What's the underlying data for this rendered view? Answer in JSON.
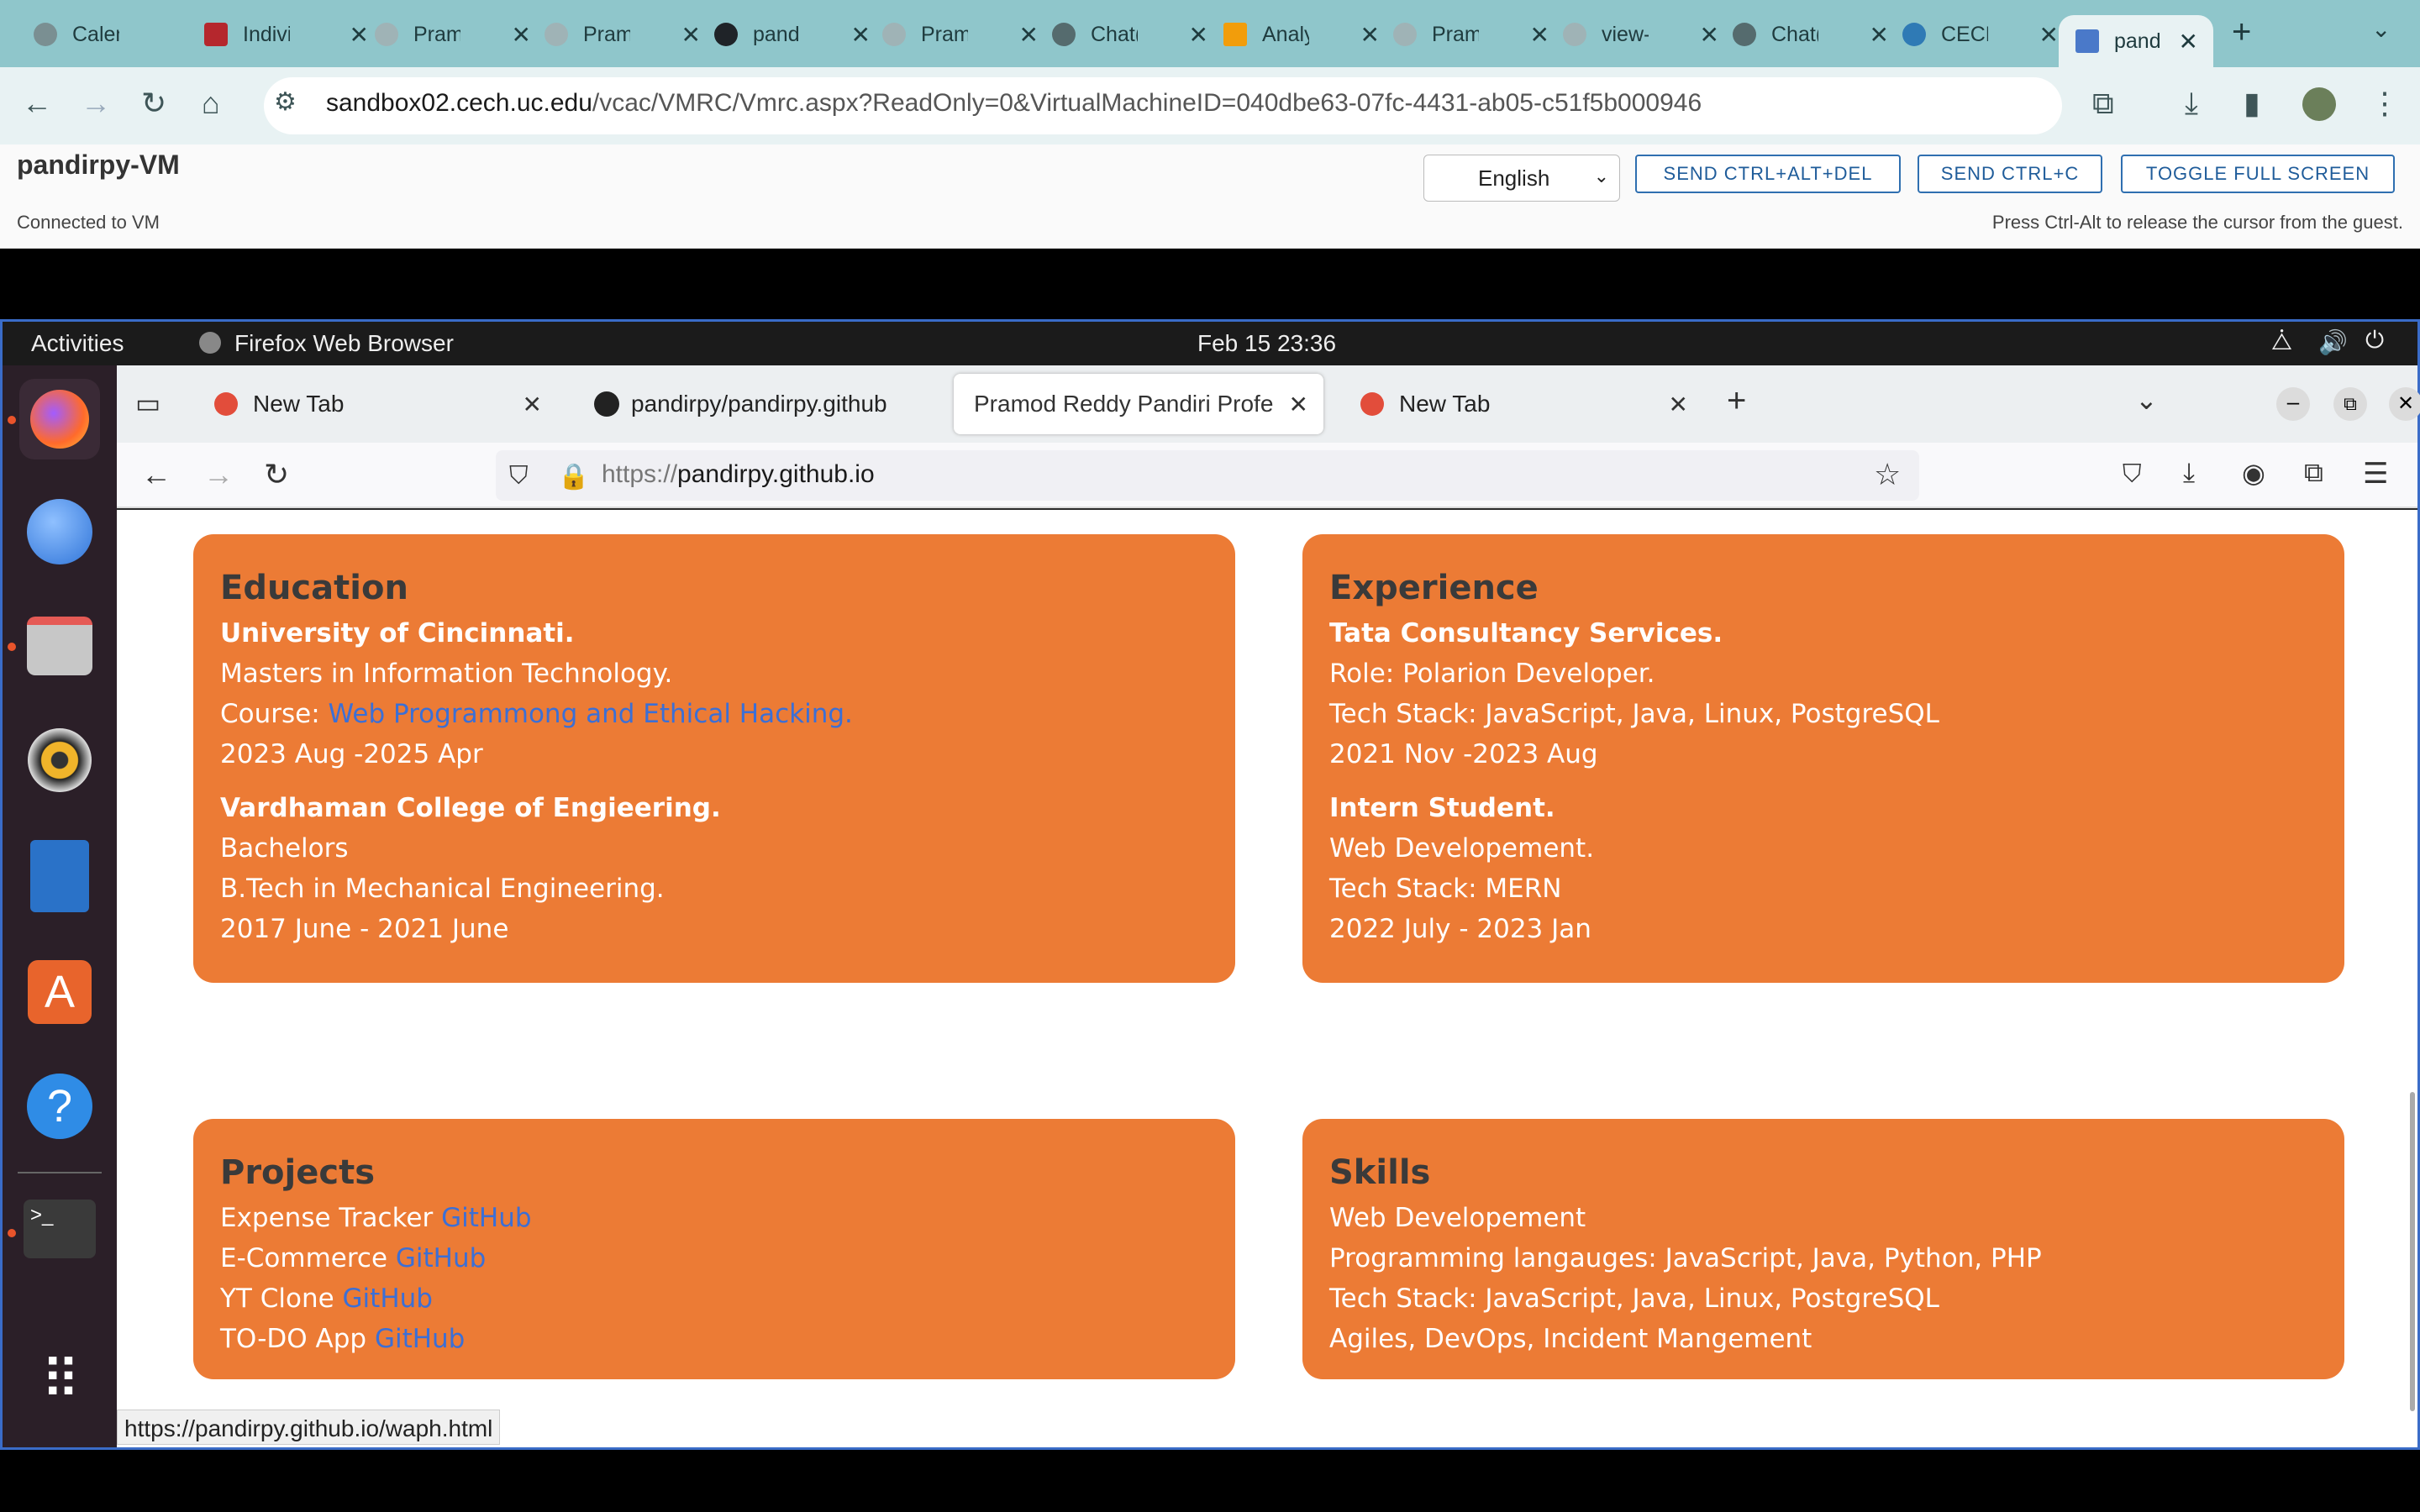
{
  "chrome": {
    "tabs": [
      {
        "label": "Calen"
      },
      {
        "label": "Indivi"
      },
      {
        "label": "Pram"
      },
      {
        "label": "Pram"
      },
      {
        "label": "pand"
      },
      {
        "label": "Pram"
      },
      {
        "label": "Chat("
      },
      {
        "label": "Analy"
      },
      {
        "label": "Pram"
      },
      {
        "label": "view-"
      },
      {
        "label": "Chat("
      },
      {
        "label": "CECH"
      },
      {
        "label": "pand"
      }
    ],
    "new_tab": "+",
    "close": "✕",
    "url_host": "sandbox02.cech.uc.edu",
    "url_path": "/vcac/VMRC/Vmrc.aspx?ReadOnly=0&VirtualMachineID=040dbe63-07fc-4431-ab05-c51f5b000946"
  },
  "vmrc": {
    "title": "pandirpy-VM",
    "status": "Connected to VM",
    "hint": "Press Ctrl-Alt to release the cursor from the guest.",
    "language": "English",
    "btn_cad": "SEND CTRL+ALT+DEL",
    "btn_cc": "SEND CTRL+C",
    "btn_fs": "TOGGLE FULL SCREEN"
  },
  "gnome": {
    "activities": "Activities",
    "app": "Firefox Web Browser",
    "clock": "Feb 15  23:36"
  },
  "firefox": {
    "tabs": [
      {
        "label": "New Tab"
      },
      {
        "label": "pandirpy/pandirpy.github"
      },
      {
        "label": "Pramod Reddy Pandiri Profe"
      },
      {
        "label": "New Tab"
      }
    ],
    "url_scheme": "https://",
    "url_host": "pandirpy.github.io",
    "status_link": "https://pandirpy.github.io/waph.html"
  },
  "page": {
    "education": {
      "heading": "Education",
      "inst1": "University of Cincinnati.",
      "deg1": "Masters in Information Technology.",
      "course_label": "Course: ",
      "course_link": "Web Programmong and Ethical Hacking.",
      "dates1": "2023 Aug -2025 Apr",
      "inst2": "Vardhaman College of Engieering.",
      "deg2": "Bachelors",
      "major2": "B.Tech in Mechanical Engineering.",
      "dates2": "2017 June - 2021 June"
    },
    "experience": {
      "heading": "Experience",
      "org1": "Tata Consultancy Services.",
      "role1": "Role: Polarion Developer.",
      "stack1": "Tech Stack: JavaScript, Java, Linux, PostgreSQL",
      "dates1": "2021 Nov -2023 Aug",
      "org2": "Intern Student.",
      "role2": "Web Developement.",
      "stack2": "Tech Stack: MERN",
      "dates2": "2022 July - 2023 Jan"
    },
    "projects": {
      "heading": "Projects",
      "link": "GitHub",
      "items": [
        "Expense Tracker ",
        "E-Commerce ",
        "YT Clone ",
        "TO-DO App "
      ]
    },
    "skills": {
      "heading": "Skills",
      "items": [
        "Web Developement",
        "Programming langauges: JavaScript, Java, Python, PHP",
        "Tech Stack: JavaScript, Java, Linux, PostgreSQL",
        "Agiles, DevOps, Incident Mangement"
      ]
    }
  },
  "colors": {
    "card": "#ec7b35",
    "link": "#3b6fd6",
    "heading": "#3a3a3a"
  }
}
